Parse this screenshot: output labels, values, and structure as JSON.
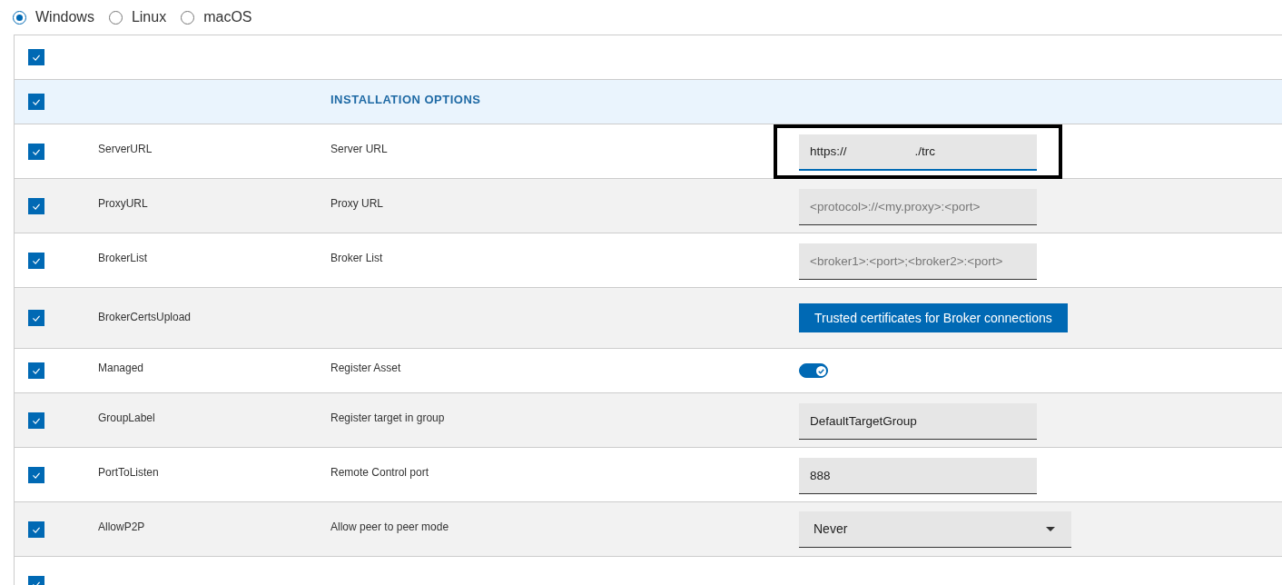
{
  "os_options": [
    {
      "label": "Windows",
      "selected": true
    },
    {
      "label": "Linux",
      "selected": false
    },
    {
      "label": "macOS",
      "selected": false
    }
  ],
  "table": {
    "select_all": {
      "checked": true
    },
    "section": {
      "title": "INSTALLATION OPTIONS",
      "checked": true
    },
    "rows": [
      {
        "kind": "text",
        "checked": true,
        "name": "ServerURL",
        "label": "Server URL",
        "value": "https://                    ./trc",
        "highlighted": true
      },
      {
        "kind": "text",
        "checked": true,
        "name": "ProxyURL",
        "label": "Proxy URL",
        "placeholder": "<protocol>://<my.proxy>:<port>",
        "highlighted": false
      },
      {
        "kind": "text",
        "checked": true,
        "name": "BrokerList",
        "label": "Broker List",
        "placeholder": "<broker1>:<port>;<broker2>:<port>",
        "highlighted": false
      },
      {
        "kind": "button",
        "checked": true,
        "name": "BrokerCertsUpload",
        "button": "Trusted certificates for Broker connections"
      },
      {
        "kind": "toggle",
        "checked": true,
        "name": "Managed",
        "label": "Register Asset",
        "on": true
      },
      {
        "kind": "text",
        "checked": true,
        "name": "GroupLabel",
        "label": "Register target in group",
        "value": "DefaultTargetGroup",
        "highlighted": false
      },
      {
        "kind": "text",
        "checked": true,
        "name": "PortToListen",
        "label": "Remote Control port",
        "value": "888",
        "highlighted": false
      },
      {
        "kind": "select",
        "checked": true,
        "name": "AllowP2P",
        "label": "Allow peer to peer mode",
        "value": "Never"
      },
      {
        "kind": "blank",
        "checked": true
      }
    ]
  }
}
